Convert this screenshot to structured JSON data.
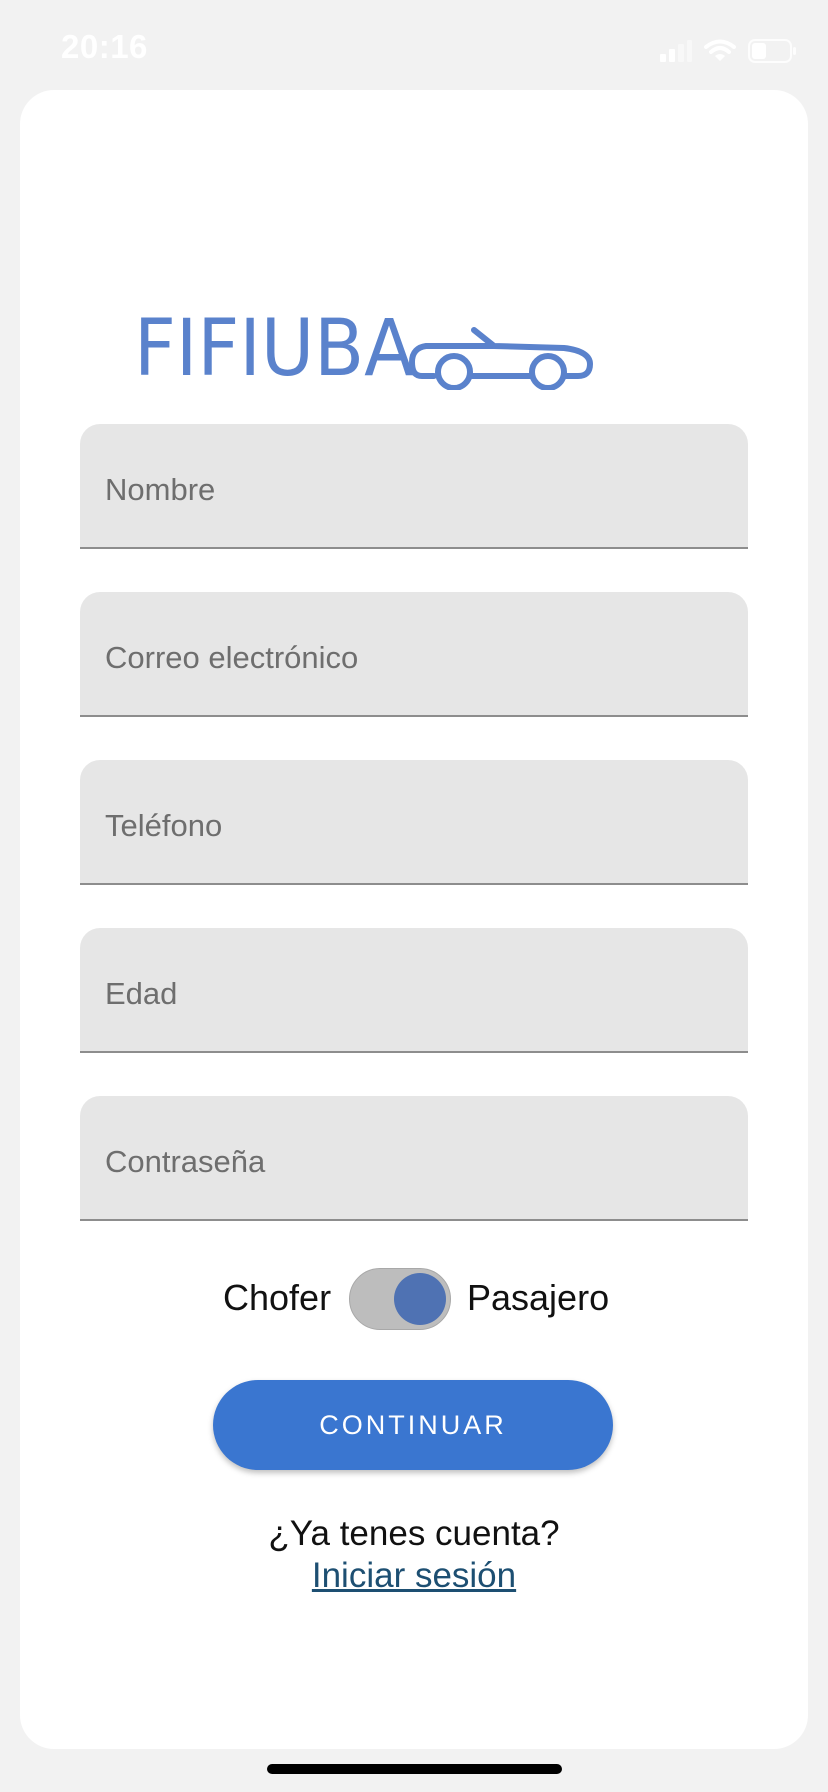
{
  "status_bar": {
    "time": "20:16",
    "icons": [
      "signal-icon",
      "wifi-icon",
      "battery-icon"
    ]
  },
  "logo": {
    "text": "FIFIUBA",
    "icon": "car-icon",
    "color": "#5a82cc"
  },
  "form": {
    "fields": [
      {
        "label": "Nombre"
      },
      {
        "label": "Correo electrónico"
      },
      {
        "label": "Teléfono"
      },
      {
        "label": "Edad"
      },
      {
        "label": "Contraseña"
      }
    ],
    "role_toggle": {
      "left_label": "Chofer",
      "right_label": "Pasajero",
      "selected": "Pasajero"
    },
    "continue_label": "CONTINUAR"
  },
  "footer": {
    "question": "¿Ya tenes cuenta?",
    "signin_link": "Iniciar sesión"
  },
  "colors": {
    "accent": "#3a76d0",
    "toggle_thumb": "#4f72b3",
    "link": "#1d4f72",
    "field_bg": "#e6e6e6"
  }
}
